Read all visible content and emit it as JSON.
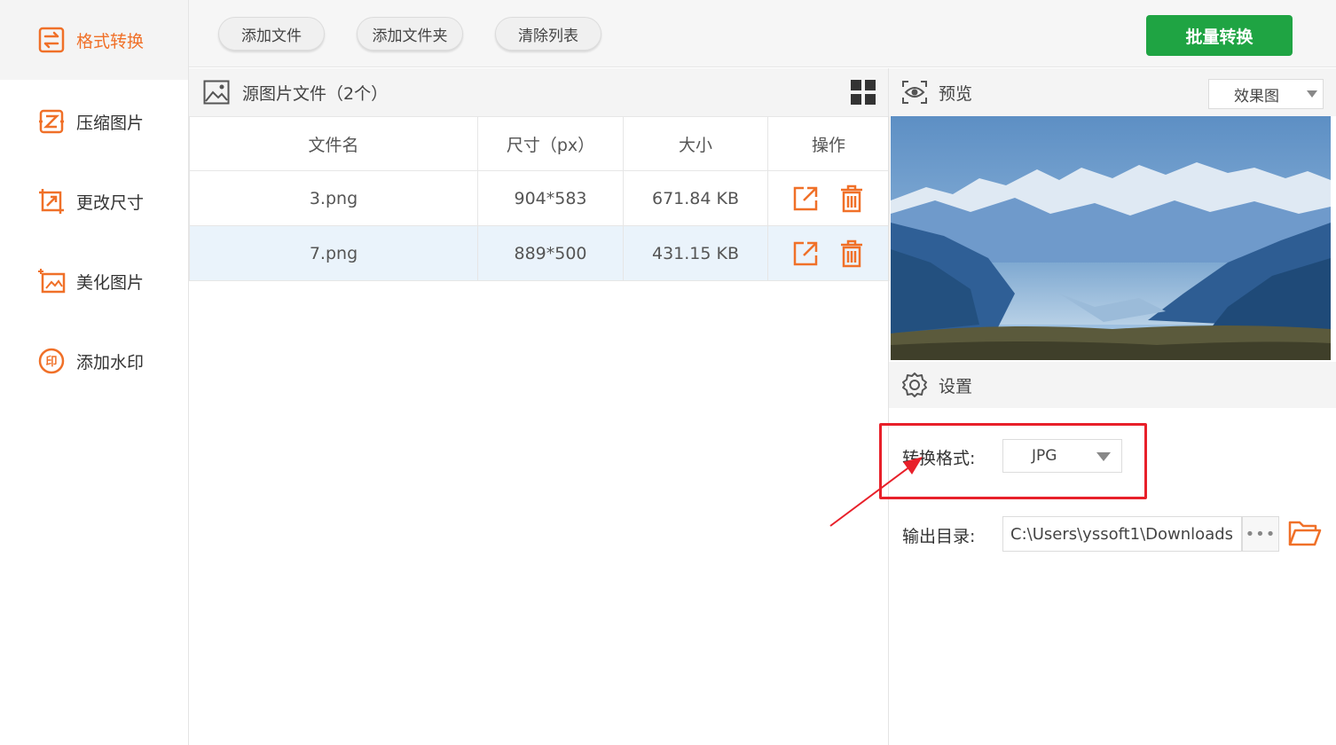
{
  "sidebar": {
    "items": [
      {
        "label": "格式转换",
        "icon": "format-convert-icon",
        "active": true
      },
      {
        "label": "压缩图片",
        "icon": "compress-icon"
      },
      {
        "label": "更改尺寸",
        "icon": "resize-icon"
      },
      {
        "label": "美化图片",
        "icon": "beautify-icon"
      },
      {
        "label": "添加水印",
        "icon": "watermark-icon"
      }
    ]
  },
  "toolbar": {
    "add_file": "添加文件",
    "add_folder": "添加文件夹",
    "clear_list": "清除列表",
    "batch_convert": "批量转换"
  },
  "file_list": {
    "title": "源图片文件（2个）",
    "columns": [
      "文件名",
      "尺寸（px）",
      "大小",
      "操作"
    ],
    "rows": [
      {
        "name": "3.png",
        "dimensions": "904*583",
        "size": "671.84 KB",
        "selected": false
      },
      {
        "name": "7.png",
        "dimensions": "889*500",
        "size": "431.15 KB",
        "selected": true
      }
    ]
  },
  "preview": {
    "title": "预览",
    "mode": "效果图"
  },
  "settings": {
    "title": "设置",
    "format_label": "转换格式:",
    "format_value": "JPG",
    "output_label": "输出目录:",
    "output_value": "C:\\Users\\yssoft1\\Downloads",
    "more_label": "•••"
  },
  "colors": {
    "accent": "#f07028",
    "primary_button": "#1fa443",
    "highlight": "#e8202a",
    "selected_row": "#eaf3fb"
  }
}
